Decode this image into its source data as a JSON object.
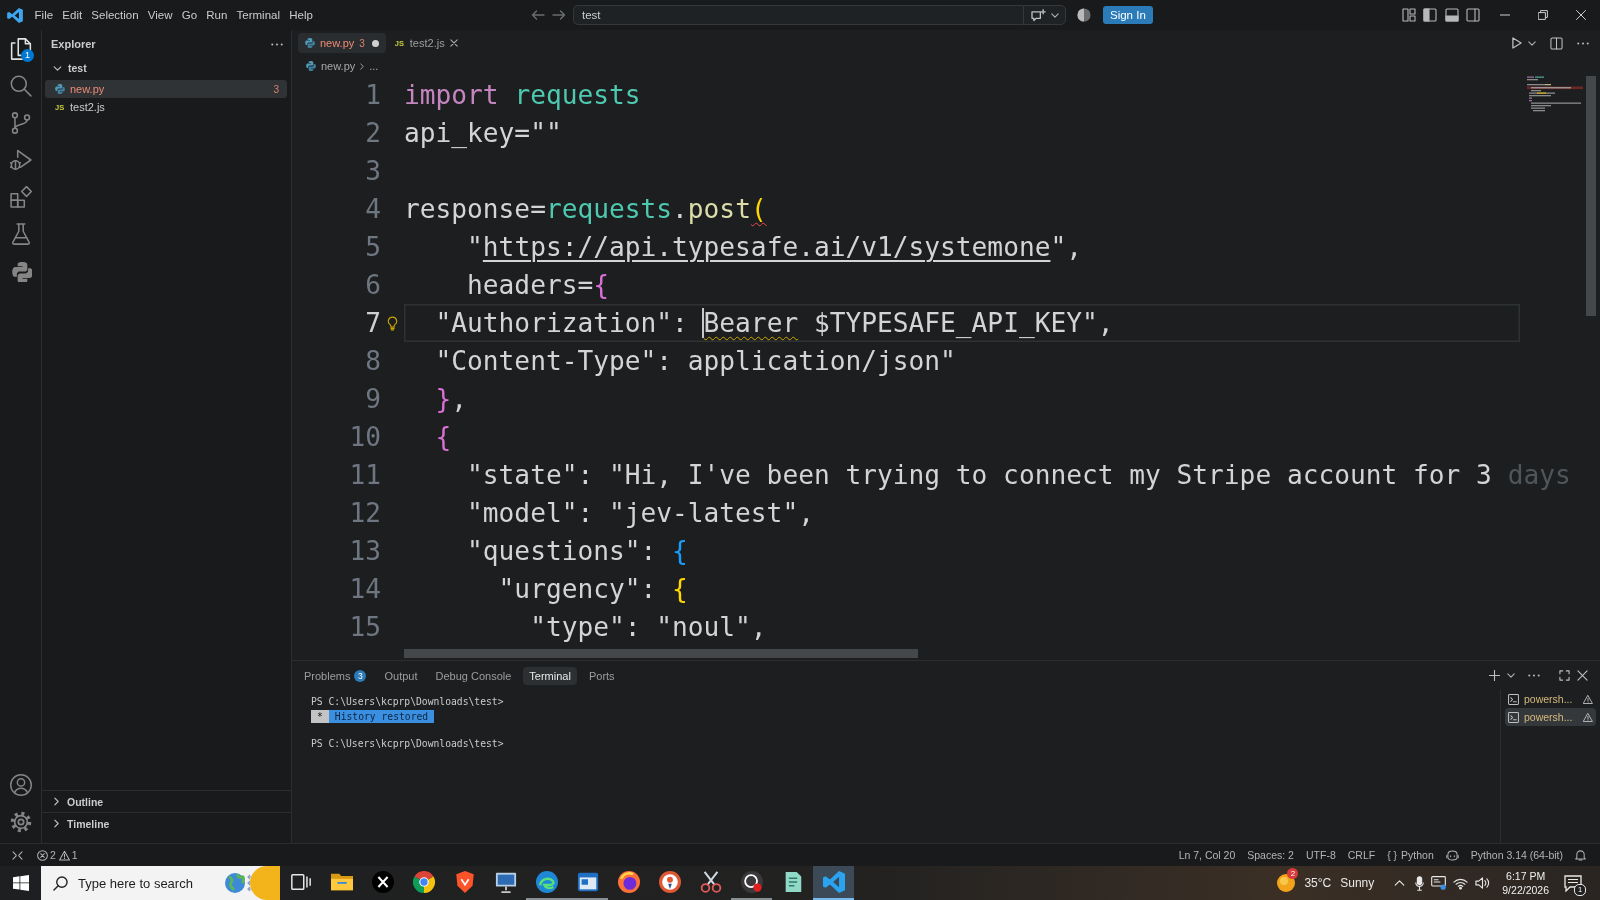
{
  "title_bar": {
    "menu": [
      "File",
      "Edit",
      "Selection",
      "View",
      "Go",
      "Run",
      "Terminal",
      "Help"
    ],
    "command_center": {
      "value": "test"
    },
    "sign_in": "Sign In"
  },
  "activity_bar": {
    "items": [
      {
        "kind": "files",
        "selected": true,
        "badge": "1"
      },
      {
        "kind": "search",
        "selected": false
      },
      {
        "kind": "source-control",
        "selected": false
      },
      {
        "kind": "run-debug",
        "selected": false
      },
      {
        "kind": "extensions",
        "selected": false
      },
      {
        "kind": "testing",
        "selected": false
      },
      {
        "kind": "python",
        "selected": false
      }
    ]
  },
  "sidebar": {
    "title": "Explorer",
    "folder": {
      "name": "test",
      "expanded": true,
      "children": [
        {
          "name": "new.py",
          "kind": "python",
          "selected": true,
          "error": true,
          "problems": "3"
        },
        {
          "name": "test2.js",
          "kind": "js",
          "icon_label": "JS",
          "selected": false,
          "error": false
        }
      ]
    },
    "sections": [
      {
        "name": "Outline",
        "expanded": false
      },
      {
        "name": "Timeline",
        "expanded": false
      }
    ]
  },
  "editor": {
    "tabs": [
      {
        "name": "new.py",
        "kind": "python",
        "selected": true,
        "error": true,
        "problems": "3",
        "dirty": true
      },
      {
        "name": "test2.js",
        "kind": "js",
        "icon_label": "JS",
        "selected": false,
        "error": false,
        "dirty": false
      }
    ],
    "breadcrumb": [
      {
        "name": "new.py",
        "kind": "python"
      },
      {
        "name": "..."
      }
    ],
    "lines": [
      {
        "number": "1",
        "current": false,
        "tokens": [
          {
            "text": "import",
            "kind": "keyword",
            "error": false,
            "warning": false,
            "cursor": false
          },
          {
            "text": " requests",
            "kind": "module",
            "error": false,
            "warning": false,
            "cursor": false
          }
        ]
      },
      {
        "number": "2",
        "current": false,
        "tokens": [
          {
            "text": "api_key=\"\"",
            "kind": "plain",
            "error": false,
            "warning": false,
            "cursor": false
          }
        ]
      },
      {
        "number": "3",
        "current": false
      },
      {
        "number": "4",
        "current": false,
        "tokens": [
          {
            "text": "response=",
            "kind": "plain",
            "error": false,
            "warning": false,
            "cursor": false
          },
          {
            "text": "requests",
            "kind": "module",
            "error": false,
            "warning": false,
            "cursor": false
          },
          {
            "text": ".",
            "kind": "plain",
            "error": false,
            "warning": false,
            "cursor": false
          },
          {
            "text": "post",
            "kind": "function",
            "error": false,
            "warning": false,
            "cursor": false
          },
          {
            "text": "(",
            "kind": "bracket1",
            "error": true,
            "warning": false,
            "cursor": false
          }
        ]
      },
      {
        "number": "5",
        "current": false,
        "tokens": [
          {
            "text": "    \"",
            "kind": "plain",
            "error": false,
            "warning": false,
            "cursor": false
          },
          {
            "text": "https://api.typesafe.ai/v1/systemone",
            "kind": "link",
            "error": false,
            "warning": false,
            "cursor": false
          },
          {
            "text": "\",",
            "kind": "plain",
            "error": false,
            "warning": false,
            "cursor": false
          }
        ]
      },
      {
        "number": "6",
        "current": false,
        "tokens": [
          {
            "text": "    headers=",
            "kind": "plain",
            "error": false,
            "warning": false,
            "cursor": false
          },
          {
            "text": "{",
            "kind": "bracket2",
            "error": false,
            "warning": false,
            "cursor": false
          }
        ]
      },
      {
        "number": "7",
        "current": true,
        "lightbulb": true,
        "tokens": [
          {
            "text": "  \"Authorization\": ",
            "kind": "plain",
            "error": false,
            "warning": false,
            "cursor": false
          },
          {
            "text": "Bearer",
            "kind": "plain",
            "error": false,
            "warning": true,
            "cursor": true
          },
          {
            "text": " $TYPESAFE_API_KEY\",",
            "kind": "plain",
            "error": false,
            "warning": false,
            "cursor": false
          }
        ]
      },
      {
        "number": "8",
        "current": false,
        "tokens": [
          {
            "text": "  \"Content-Type\": application/json\"",
            "kind": "plain",
            "error": false,
            "warning": false,
            "cursor": false
          }
        ]
      },
      {
        "number": "9",
        "current": false,
        "tokens": [
          {
            "text": "  }",
            "kind": "bracket2",
            "error": false,
            "warning": false,
            "cursor": false
          },
          {
            "text": ",",
            "kind": "plain",
            "error": false,
            "warning": false,
            "cursor": false
          }
        ]
      },
      {
        "number": "10",
        "current": false,
        "tokens": [
          {
            "text": "  {",
            "kind": "bracket2",
            "error": false,
            "warning": false,
            "cursor": false
          }
        ]
      },
      {
        "number": "11",
        "current": false,
        "tokens": [
          {
            "text": "    \"state\": \"Hi, I've been trying to connect my Stripe account for 3 ",
            "kind": "plain",
            "error": false,
            "warning": false,
            "cursor": false
          },
          {
            "text": "days",
            "kind": "faded",
            "error": false,
            "warning": false,
            "cursor": false
          }
        ]
      },
      {
        "number": "12",
        "current": false,
        "tokens": [
          {
            "text": "    \"model\": \"jev-latest\",",
            "kind": "plain",
            "error": false,
            "warning": false,
            "cursor": false
          }
        ]
      },
      {
        "number": "13",
        "current": false,
        "tokens": [
          {
            "text": "    \"questions\": ",
            "kind": "plain",
            "error": false,
            "warning": false,
            "cursor": false
          },
          {
            "text": "{",
            "kind": "bracket3",
            "error": false,
            "warning": false,
            "cursor": false
          }
        ]
      },
      {
        "number": "14",
        "current": false,
        "tokens": [
          {
            "text": "      \"urgency\": ",
            "kind": "plain",
            "error": false,
            "warning": false,
            "cursor": false
          },
          {
            "text": "{",
            "kind": "bracket1",
            "error": false,
            "warning": false,
            "cursor": false
          }
        ]
      },
      {
        "number": "15",
        "current": false,
        "tokens": [
          {
            "text": "        \"type\": \"noul\",",
            "kind": "plain",
            "error": false,
            "warning": false,
            "cursor": false
          }
        ]
      }
    ]
  },
  "panel": {
    "tabs": [
      {
        "label": "Problems",
        "badge": "3",
        "selected": false
      },
      {
        "label": "Output",
        "selected": false
      },
      {
        "label": "Debug Console",
        "selected": false
      },
      {
        "label": "Terminal",
        "selected": true
      },
      {
        "label": "Ports",
        "selected": false
      }
    ],
    "terminal": {
      "lines": [
        {
          "kind": "prompt",
          "text": "PS C:\\Users\\kcprp\\Downloads\\test>"
        },
        {
          "kind": "notice",
          "mark": "*",
          "text": "History restored"
        },
        {
          "kind": "blank"
        },
        {
          "kind": "prompt",
          "text": "PS C:\\Users\\kcprp\\Downloads\\test>"
        }
      ]
    },
    "instances": [
      {
        "label": "powersh...",
        "selected": false
      },
      {
        "label": "powersh...",
        "selected": true
      }
    ]
  },
  "status_bar": {
    "errors": "2",
    "warnings": "1",
    "position": "Ln 7, Col 20",
    "indentation": "Spaces: 2",
    "encoding": "UTF-8",
    "line_ending": "CRLF",
    "language_icon": "{ }",
    "language": "Python",
    "interpreter": "Python 3.14 (64-bit)"
  },
  "taskbar": {
    "search_placeholder": "Type here to search",
    "apps": [
      {
        "kind": "task-view",
        "running": false,
        "selected": false
      },
      {
        "kind": "folder",
        "running": false,
        "selected": false
      },
      {
        "kind": "x-logo",
        "running": false,
        "selected": false
      },
      {
        "kind": "segment-ball",
        "running": false,
        "selected": false
      },
      {
        "kind": "shield",
        "running": false,
        "selected": false
      },
      {
        "kind": "monitor",
        "running": false,
        "selected": false
      },
      {
        "kind": "swirl",
        "running": true,
        "selected": false
      },
      {
        "kind": "app-window",
        "running": true,
        "selected": false
      },
      {
        "kind": "flame-ball",
        "running": false,
        "selected": false
      },
      {
        "kind": "duck",
        "running": false,
        "selected": false
      },
      {
        "kind": "scissors",
        "running": false,
        "selected": false
      },
      {
        "kind": "ring",
        "running": true,
        "selected": false
      },
      {
        "kind": "notepad",
        "running": false,
        "selected": false
      },
      {
        "kind": "code",
        "running": true,
        "selected": true
      }
    ],
    "weather": {
      "badge": "2",
      "temperature": "35°C",
      "condition": "Sunny"
    },
    "clock": {
      "time": "6:17 PM",
      "date": "9/22/2026"
    },
    "notification_badge": "1"
  }
}
